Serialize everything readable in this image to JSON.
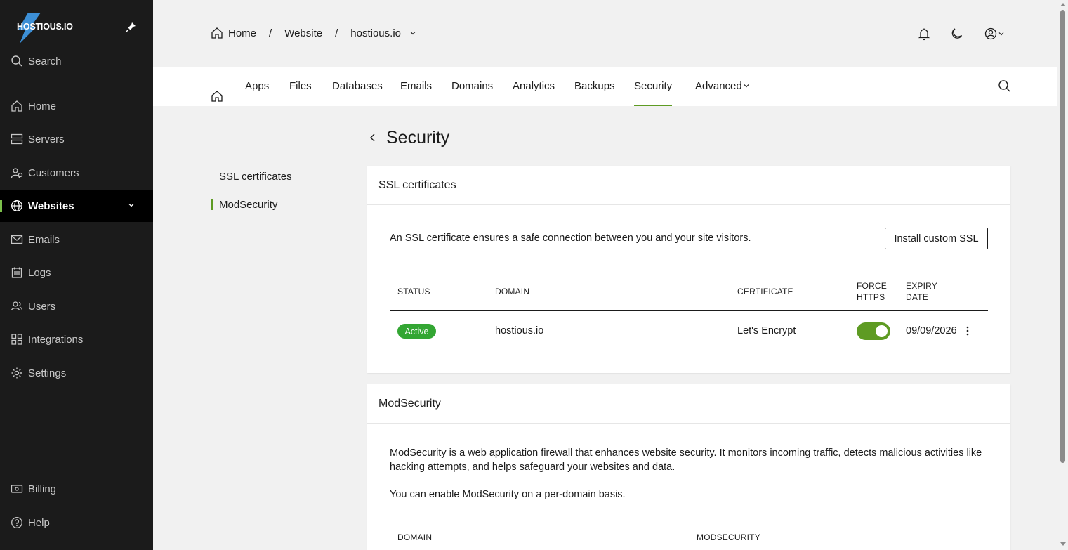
{
  "brand": {
    "name": "HOSTIOUS.IO"
  },
  "sidebar": {
    "search_label": "Search",
    "items": [
      {
        "label": "Home",
        "icon": "home-icon"
      },
      {
        "label": "Servers",
        "icon": "servers-icon"
      },
      {
        "label": "Customers",
        "icon": "customers-icon"
      },
      {
        "label": "Websites",
        "icon": "globe-icon",
        "active": true
      },
      {
        "label": "Emails",
        "icon": "mail-icon"
      },
      {
        "label": "Logs",
        "icon": "logs-icon"
      },
      {
        "label": "Users",
        "icon": "users-icon"
      },
      {
        "label": "Integrations",
        "icon": "integrations-icon"
      },
      {
        "label": "Settings",
        "icon": "gear-icon"
      }
    ],
    "bottom_items": [
      {
        "label": "Billing",
        "icon": "billing-icon"
      },
      {
        "label": "Help",
        "icon": "help-icon"
      }
    ]
  },
  "breadcrumb": {
    "home": "Home",
    "section": "Website",
    "current": "hostious.io"
  },
  "tabs": {
    "items": [
      "Apps",
      "Files",
      "Databases",
      "Emails",
      "Domains",
      "Analytics",
      "Backups",
      "Security",
      "Advanced"
    ],
    "active": "Security"
  },
  "subnav": {
    "items": [
      "SSL certificates",
      "ModSecurity"
    ],
    "active": "ModSecurity"
  },
  "page": {
    "title": "Security"
  },
  "ssl": {
    "title": "SSL certificates",
    "description": "An SSL certificate ensures a safe connection between you and your site visitors.",
    "install_button": "Install custom SSL",
    "columns": {
      "status": "STATUS",
      "domain": "DOMAIN",
      "certificate": "CERTIFICATE",
      "force_https_1": "FORCE",
      "force_https_2": "HTTPS",
      "expiry_1": "EXPIRY",
      "expiry_2": "DATE"
    },
    "rows": [
      {
        "status": "Active",
        "domain": "hostious.io",
        "certificate": "Let's Encrypt",
        "force_https": true,
        "expiry": "09/09/2026"
      }
    ]
  },
  "modsecurity": {
    "title": "ModSecurity",
    "description_1": "ModSecurity is a web application firewall that enhances website security. It monitors incoming traffic, detects malicious activities like",
    "description_2": "hacking attempts, and helps safeguard your websites and data.",
    "note": "You can enable ModSecurity on a per-domain basis.",
    "columns": {
      "domain": "DOMAIN",
      "modsecurity": "MODSECURITY"
    }
  },
  "colors": {
    "accent": "#5e9b23",
    "active_badge": "#33a633",
    "sidebar_bg": "#1b1b1b"
  }
}
